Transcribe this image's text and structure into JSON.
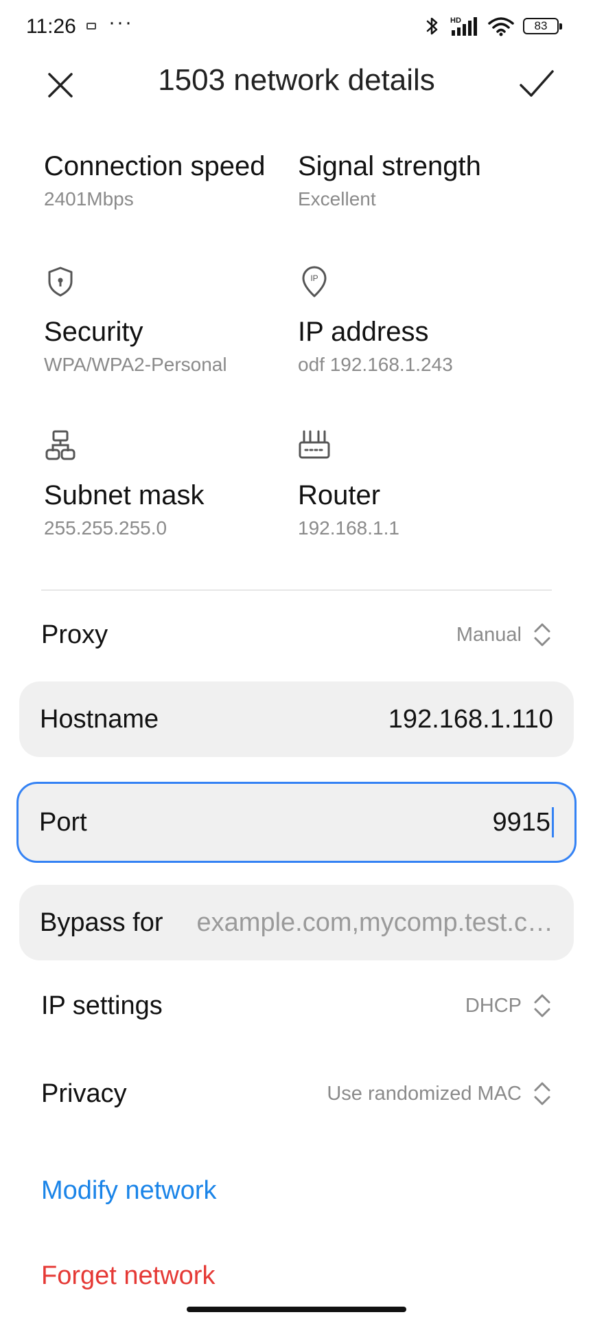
{
  "status_bar": {
    "time": "11:26",
    "more": "···",
    "battery": "83",
    "network_badge": "HD"
  },
  "header": {
    "title": "1503 network details"
  },
  "info": {
    "connection_speed": {
      "label": "Connection speed",
      "value": "2401Mbps"
    },
    "signal_strength": {
      "label": "Signal strength",
      "value": "Excellent"
    },
    "security": {
      "label": "Security",
      "value": "WPA/WPA2-Personal",
      "icon": "shield-icon"
    },
    "ip_address": {
      "label": "IP address",
      "value": "odf 192.168.1.243",
      "icon": "location-ip-icon",
      "icon_text": "IP"
    },
    "subnet_mask": {
      "label": "Subnet mask",
      "value": "255.255.255.0",
      "icon": "network-tree-icon"
    },
    "router": {
      "label": "Router",
      "value": "192.168.1.1",
      "icon": "router-icon"
    }
  },
  "proxy": {
    "label": "Proxy",
    "value": "Manual"
  },
  "hostname": {
    "label": "Hostname",
    "value": "192.168.1.110"
  },
  "port": {
    "label": "Port",
    "value": "9915"
  },
  "bypass": {
    "label": "Bypass for",
    "placeholder": "example.com,mycomp.test.c…"
  },
  "ip_settings": {
    "label": "IP settings",
    "value": "DHCP"
  },
  "privacy": {
    "label": "Privacy",
    "value": "Use randomized MAC"
  },
  "actions": {
    "modify": "Modify network",
    "forget": "Forget network"
  },
  "colors": {
    "accent": "#3482f4",
    "link": "#1a84e8",
    "danger": "#e53935",
    "field_bg": "#f0f0f0"
  }
}
